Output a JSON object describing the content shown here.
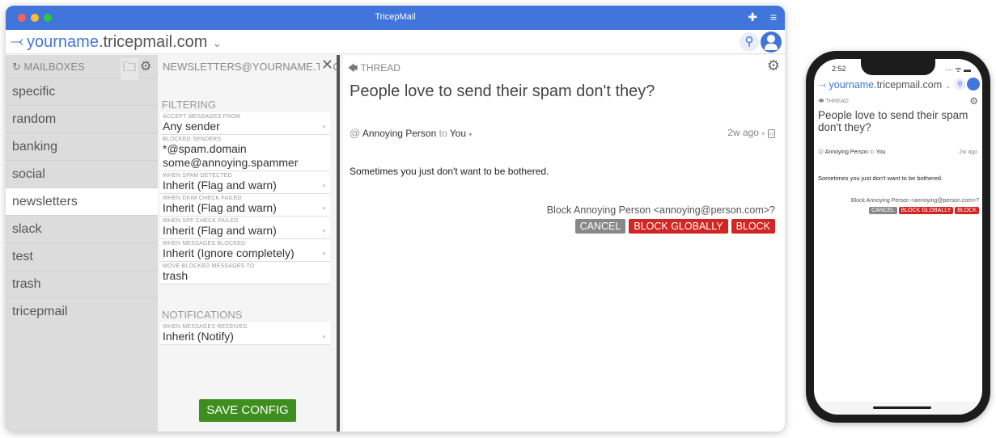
{
  "app": {
    "title": "TricepMail"
  },
  "colors": {
    "brand": "#4175db",
    "danger": "#d12623",
    "cancel": "#888888",
    "save": "#3d8e1f"
  },
  "address": {
    "name": "yourname",
    "domain": ".tricepmail.com",
    "chevron": "⌄"
  },
  "icons": {
    "logo": "⤙",
    "puzzle": "✚",
    "menu": "≡",
    "search": "⚲",
    "sync": "↻",
    "folder": "▬",
    "gear": "⚙",
    "close": "✕",
    "back": "🡄",
    "caret": "▾",
    "at": "@",
    "code": "‹›"
  },
  "sidebar": {
    "header": "MAILBOXES",
    "items": [
      {
        "label": "specific"
      },
      {
        "label": "random"
      },
      {
        "label": "banking"
      },
      {
        "label": "social"
      },
      {
        "label": "newsletters",
        "selected": true
      },
      {
        "label": "slack"
      },
      {
        "label": "test"
      },
      {
        "label": "trash"
      },
      {
        "label": "tricepmail"
      }
    ]
  },
  "config": {
    "header": "NEWSLETTERS@YOURNAME.TRIC",
    "filtering_title": "FILTERING",
    "fields": [
      {
        "label": "ACCEPT MESSAGES FROM",
        "value": "Any sender"
      },
      {
        "label": "BLOCKED SENDERS",
        "value": "*@spam.domain",
        "value2": "some@annoying.spammer"
      },
      {
        "label": "WHEN SPAM DETECTED",
        "value": "Inherit (Flag and warn)"
      },
      {
        "label": "WHEN DKIM CHECK FAILED",
        "value": "Inherit (Flag and warn)"
      },
      {
        "label": "WHEN SPF CHECK FAILED",
        "value": "Inherit (Flag and warn)"
      },
      {
        "label": "WHEN MESSAGES BLOCKED",
        "value": "Inherit (Ignore completely)"
      },
      {
        "label": "MOVE BLOCKED MESSAGES TO",
        "value": "trash"
      }
    ],
    "notifications_title": "NOTIFICATIONS",
    "notify_field": {
      "label": "WHEN MESSAGES RECEIVED",
      "value": "Inherit (Notify)"
    },
    "save_label": "SAVE CONFIG"
  },
  "thread": {
    "header": "THREAD",
    "subject": "People love to send their spam don't they?",
    "from": "Annoying Person",
    "to_word": "to",
    "to": "You",
    "time": "2w ago",
    "body": "Sometimes you just don't want to be bothered.",
    "block_prompt": "Block Annoying Person <annoying@person.com>?",
    "cancel_label": "CANCEL",
    "block_globally_label": "BLOCK GLOBALLY",
    "block_label": "BLOCK"
  },
  "phone": {
    "time": "2:52",
    "status": "··· ᯤ ▬"
  }
}
